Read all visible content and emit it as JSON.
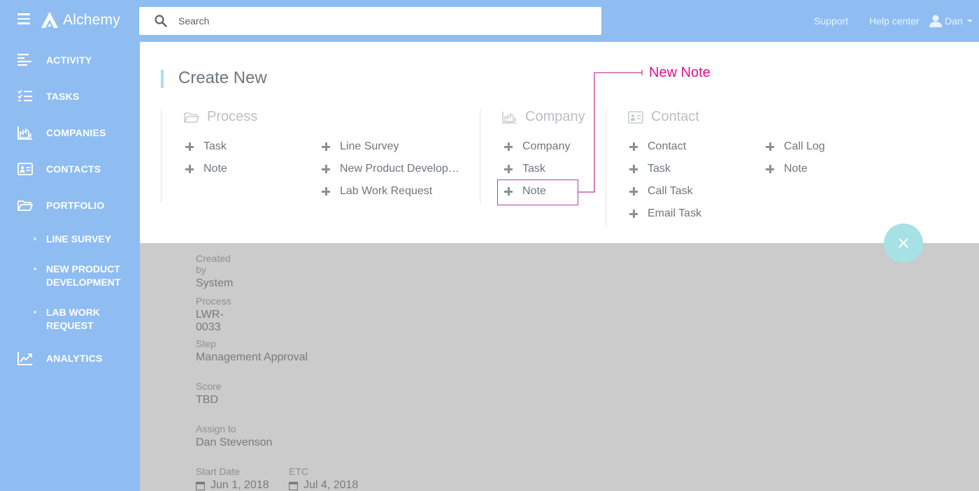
{
  "app": {
    "name": "Alchemy"
  },
  "header": {
    "search_placeholder": "Search",
    "support": "Support",
    "help_center": "Help center",
    "user_name": "Dan"
  },
  "sidebar": {
    "items": [
      {
        "label": "ACTIVITY",
        "icon": "activity-icon"
      },
      {
        "label": "TASKS",
        "icon": "tasks-icon"
      },
      {
        "label": "COMPANIES",
        "icon": "companies-icon"
      },
      {
        "label": "CONTACTS",
        "icon": "contacts-icon"
      },
      {
        "label": "PORTFOLIO",
        "icon": "folder-icon"
      },
      {
        "label": "ANALYTICS",
        "icon": "analytics-icon"
      }
    ],
    "portfolio_sub": [
      {
        "label": "LINE SURVEY"
      },
      {
        "label": "NEW PRODUCT DEVELOPMENT"
      },
      {
        "label": "LAB WORK REQUEST"
      }
    ]
  },
  "create_new": {
    "title": "Create New",
    "process": {
      "heading": "Process",
      "col1": [
        "Task",
        "Note"
      ],
      "col2": [
        "Line Survey",
        "New Product Develop…",
        "Lab Work Request"
      ]
    },
    "company": {
      "heading": "Company",
      "items": [
        "Company",
        "Task",
        "Note"
      ]
    },
    "contact": {
      "heading": "Contact",
      "col1": [
        "Contact",
        "Task",
        "Call Task",
        "Email Task"
      ],
      "col2": [
        "Call Log",
        "Note"
      ]
    }
  },
  "annotation": {
    "label": "New Note",
    "color": "#e0118c"
  },
  "details": {
    "created_by": {
      "label": "Created by",
      "value": "System"
    },
    "process": {
      "label": "Process",
      "value": "LWR-0033"
    },
    "step": {
      "label": "Step",
      "value": "Management Approval"
    },
    "score": {
      "label": "Score",
      "value": "TBD"
    },
    "assign_to": {
      "label": "Assign to",
      "value": "Dan Stevenson"
    },
    "start_date": {
      "label": "Start Date",
      "value": "Jun 1, 2018"
    },
    "etc": {
      "label": "ETC",
      "value": "Jul 4, 2018"
    }
  },
  "colors": {
    "brand": "#8fbdf2",
    "accent": "#a6e1e6",
    "overlay": "#cbcbcb"
  }
}
